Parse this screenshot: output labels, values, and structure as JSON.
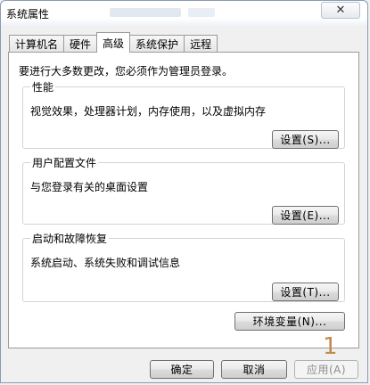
{
  "window": {
    "title": "系统属性",
    "close_glyph": "✕"
  },
  "tabs": [
    {
      "label": "计算机名",
      "active": false
    },
    {
      "label": "硬件",
      "active": false
    },
    {
      "label": "高级",
      "active": true
    },
    {
      "label": "系统保护",
      "active": false
    },
    {
      "label": "远程",
      "active": false
    }
  ],
  "notice": "要进行大多数更改，您必须作为管理员登录。",
  "groups": {
    "performance": {
      "title": "性能",
      "desc": "视觉效果，处理器计划，内存使用，以及虚拟内存",
      "button": "设置(S)..."
    },
    "profiles": {
      "title": "用户配置文件",
      "desc": "与您登录有关的桌面设置",
      "button": "设置(E)..."
    },
    "startup": {
      "title": "启动和故障恢复",
      "desc": "系统启动、系统失败和调试信息",
      "button": "设置(T)..."
    }
  },
  "env_button": "环境变量(N)...",
  "footer": {
    "ok": "确定",
    "cancel": "取消",
    "apply": "应用(A)"
  },
  "annotation": "1"
}
